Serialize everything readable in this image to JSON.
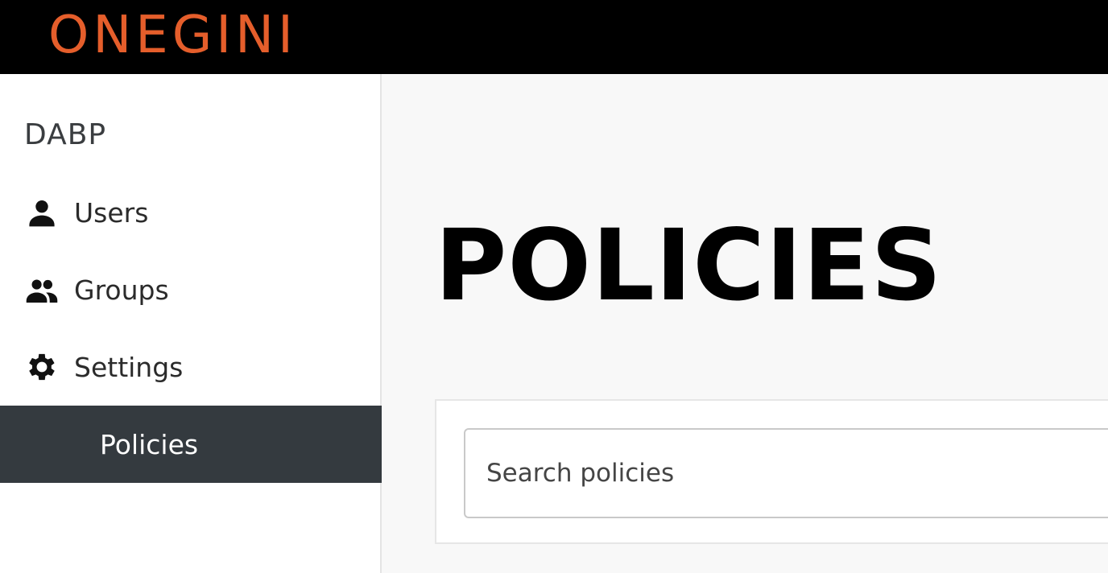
{
  "header": {
    "logo_text": "ONEGINI",
    "logo_color": "#e55e2b",
    "background": "#000000"
  },
  "sidebar": {
    "tenant": "DABP",
    "items": [
      {
        "label": "Users",
        "icon": "person-icon"
      },
      {
        "label": "Groups",
        "icon": "people-icon"
      },
      {
        "label": "Settings",
        "icon": "gear-icon"
      },
      {
        "label": "Policies",
        "icon": null,
        "active": true
      }
    ],
    "active_color": "#343a3f"
  },
  "main": {
    "title": "POLICIES",
    "search": {
      "placeholder": "Search policies",
      "value": ""
    }
  }
}
